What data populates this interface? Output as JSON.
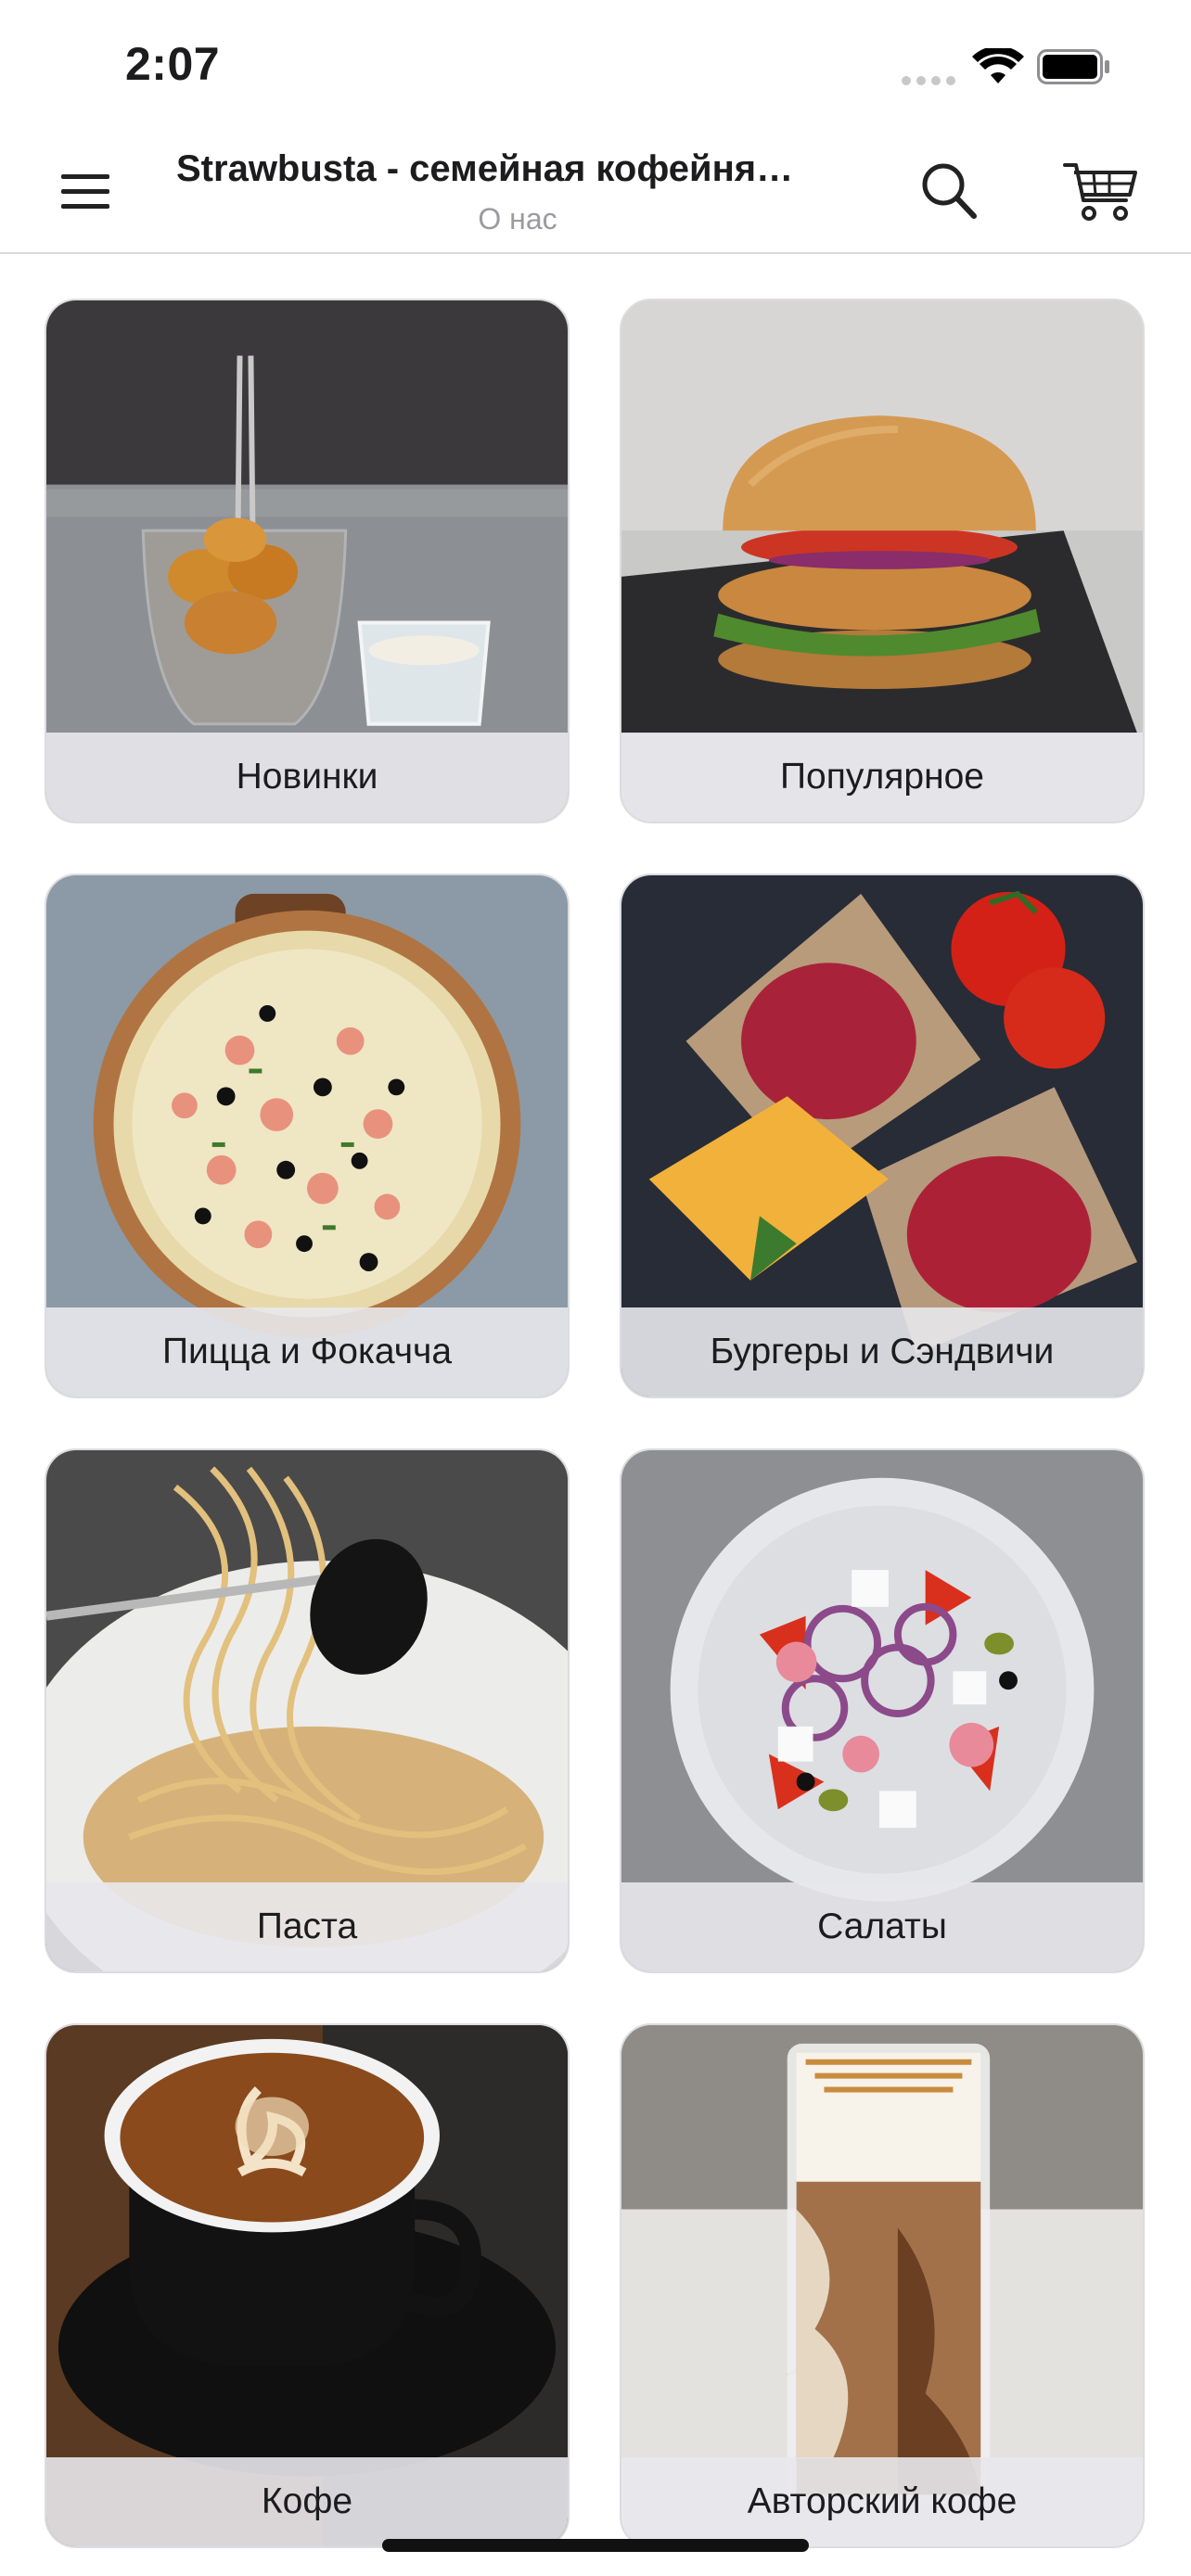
{
  "status_bar": {
    "time": "2:07"
  },
  "header": {
    "title": "Strawbusta - семейная кофейня…",
    "subtitle": "О нас"
  },
  "categories": [
    {
      "label": "Новинки"
    },
    {
      "label": "Популярное"
    },
    {
      "label": "Пицца и Фокачча"
    },
    {
      "label": "Бургеры и Сэндвичи"
    },
    {
      "label": "Паста"
    },
    {
      "label": "Салаты"
    },
    {
      "label": "Кофе"
    },
    {
      "label": "Авторский кофе"
    }
  ],
  "icons": {
    "menu": "hamburger-menu-icon",
    "search": "search-icon",
    "cart": "cart-icon"
  }
}
